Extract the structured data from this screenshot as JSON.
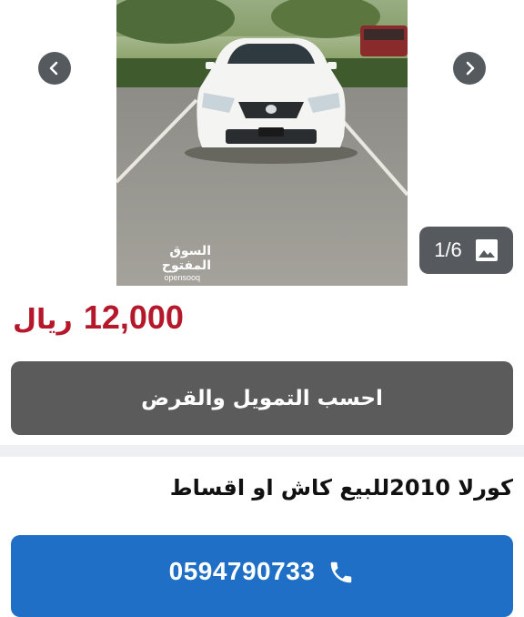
{
  "gallery": {
    "counter": "1/6",
    "counter_icon": "image-icon",
    "prev_icon": "chevron-left-icon",
    "next_icon": "chevron-right-icon",
    "watermark_ar": "السوق المفتوح",
    "watermark_en": "opensooq"
  },
  "listing": {
    "price_amount": "12,000",
    "price_currency": "ريال",
    "price_color": "#b5182a",
    "finance_button": "احسب التمويل والقرض",
    "title": "كورلا 2010للبيع كاش او اقساط",
    "phone": "0594790733",
    "phone_icon": "phone-icon",
    "call_color": "#1f6fc6"
  }
}
